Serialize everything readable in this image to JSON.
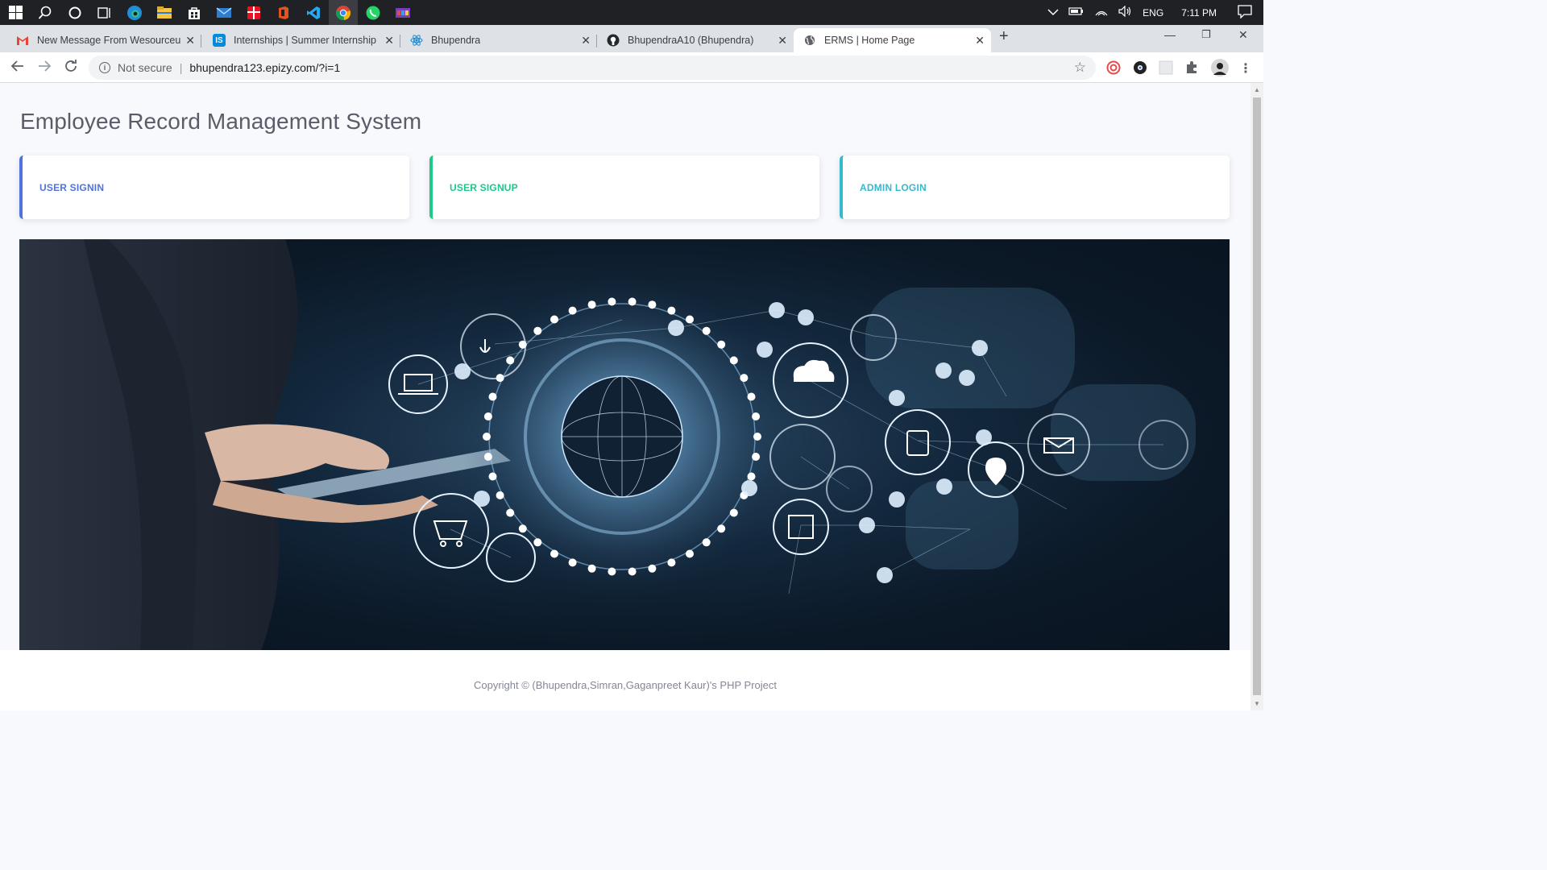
{
  "taskbar": {
    "icons": [
      "windows-start",
      "search",
      "cortana",
      "task-view",
      "edge",
      "file-explorer",
      "store",
      "mail",
      "gift",
      "office",
      "vscode",
      "chrome",
      "whatsapp",
      "media"
    ],
    "tray": {
      "language": "ENG",
      "time": "7:11 PM"
    }
  },
  "tabs": [
    {
      "title": "New Message From Wesourceu F",
      "favicon": "gmail-icon"
    },
    {
      "title": "Internships | Summer Internship :",
      "favicon": "internshala-icon"
    },
    {
      "title": "Bhupendra",
      "favicon": "react-icon"
    },
    {
      "title": "BhupendraA10 (Bhupendra)",
      "favicon": "github-icon"
    },
    {
      "title": "ERMS | Home Page",
      "favicon": "globe-icon"
    }
  ],
  "omnibox": {
    "security": "Not secure",
    "url": "bhupendra123.epizy.com/?i=1"
  },
  "page": {
    "heading": "Employee Record Management System",
    "cards": [
      {
        "label": "USER SIGNIN",
        "color": "#4e73df"
      },
      {
        "label": "USER SIGNUP",
        "color": "#1cc88a"
      },
      {
        "label": "ADMIN LOGIN",
        "color": "#36b9cc"
      }
    ],
    "footer": "Copyright © (Bhupendra,Simran,Gaganpreet Kaur)'s PHP Project"
  }
}
